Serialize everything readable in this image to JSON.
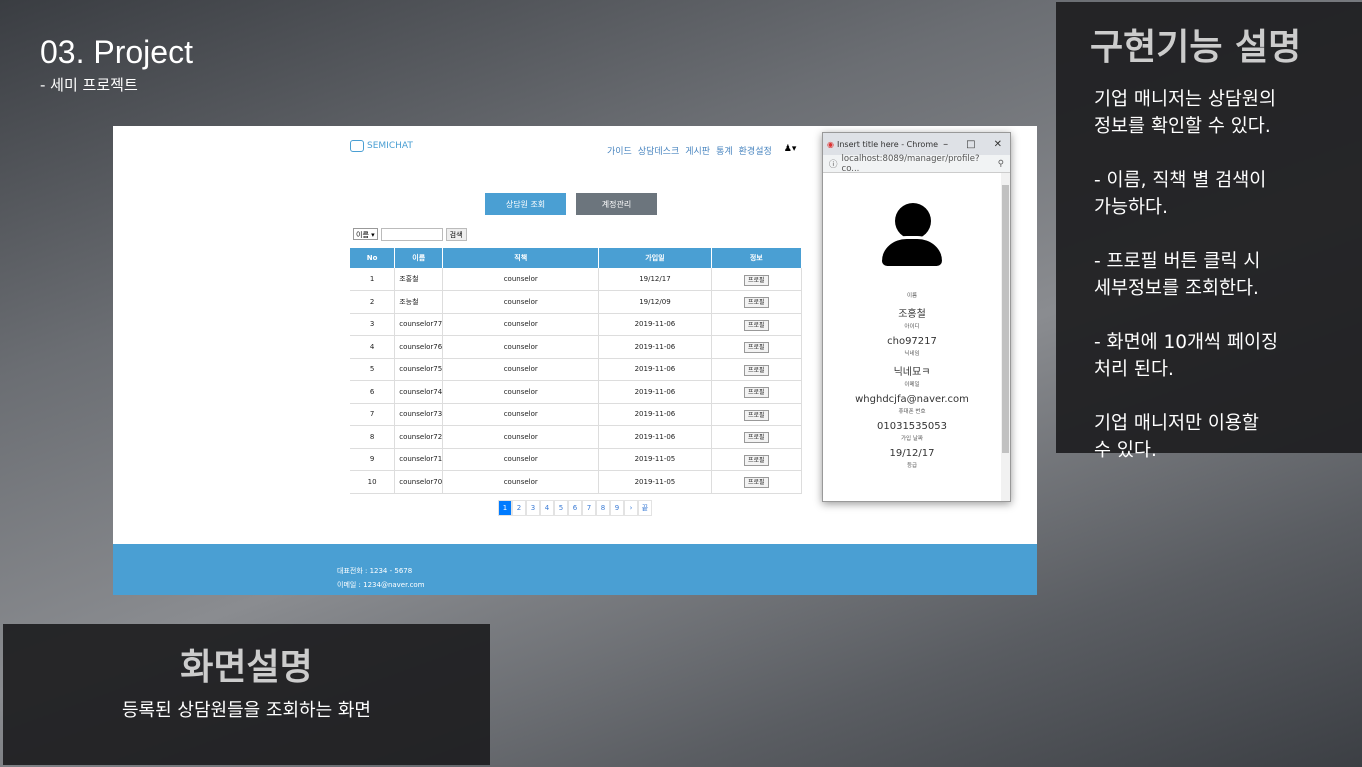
{
  "slide": {
    "title": "03. Project",
    "subtitle": "- 세미 프로젝트"
  },
  "app": {
    "logo": "SEMICHAT",
    "nav": [
      "가이드",
      "상담데스크",
      "게시판",
      "통계",
      "환경설정"
    ],
    "tabs": {
      "view": "상담원 조회",
      "manage": "계정관리"
    },
    "search": {
      "select": "이름 ▾",
      "button": "검색",
      "value": ""
    },
    "table": {
      "headers": [
        "No",
        "이름",
        "직책",
        "가입일",
        "정보"
      ],
      "rows": [
        [
          "1",
          "조홍철",
          "counselor",
          "19/12/17",
          "프로필"
        ],
        [
          "2",
          "조능철",
          "counselor",
          "19/12/09",
          "프로필"
        ],
        [
          "3",
          "counselor77",
          "counselor",
          "2019-11-06",
          "프로필"
        ],
        [
          "4",
          "counselor76",
          "counselor",
          "2019-11-06",
          "프로필"
        ],
        [
          "5",
          "counselor75",
          "counselor",
          "2019-11-06",
          "프로필"
        ],
        [
          "6",
          "counselor74",
          "counselor",
          "2019-11-06",
          "프로필"
        ],
        [
          "7",
          "counselor73",
          "counselor",
          "2019-11-06",
          "프로필"
        ],
        [
          "8",
          "counselor72",
          "counselor",
          "2019-11-06",
          "프로필"
        ],
        [
          "9",
          "counselor71",
          "counselor",
          "2019-11-05",
          "프로필"
        ],
        [
          "10",
          "counselor70",
          "counselor",
          "2019-11-05",
          "프로필"
        ]
      ]
    },
    "pager": [
      "1",
      "2",
      "3",
      "4",
      "5",
      "6",
      "7",
      "8",
      "9",
      "›",
      "끝"
    ],
    "footer": {
      "phone": "대표전화 : 1234 - 5678",
      "email": "이메일 : 1234@naver.com"
    }
  },
  "popup": {
    "title": "Insert title here - Chrome",
    "url": "localhost:8089/manager/profile?co...",
    "fields": [
      {
        "label": "이름",
        "value": "조홍철"
      },
      {
        "label": "아이디",
        "value": "cho97217"
      },
      {
        "label": "닉네임",
        "value": "닉네묘ㅋ"
      },
      {
        "label": "이메일",
        "value": "whghdcjfa@naver.com"
      },
      {
        "label": "휴대폰 번호",
        "value": "01031535053"
      },
      {
        "label": "가입 날짜",
        "value": "19/12/17"
      },
      {
        "label": "등급",
        "value": ""
      }
    ]
  },
  "right_panel": {
    "title": "구현기능 설명",
    "text": "기업 매니저는 상담원의\n정보를 확인할 수 있다.\n\n- 이름, 직책 별 검색이\n가능하다.\n\n- 프로필 버튼 클릭 시\n세부정보를 조회한다.\n\n- 화면에 10개씩 페이징\n처리 된다.\n\n기업 매니저만 이용할\n수 있다."
  },
  "left_panel": {
    "title": "화면설명",
    "text": "등록된 상담원들을 조회하는 화면"
  }
}
